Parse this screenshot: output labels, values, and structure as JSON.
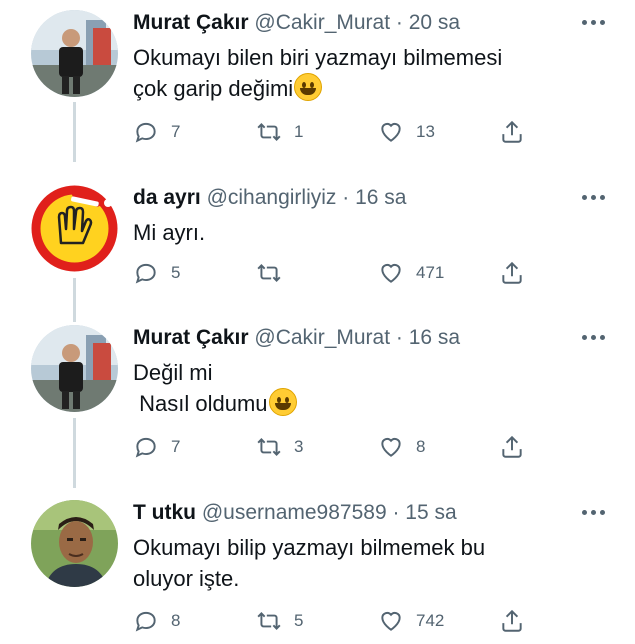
{
  "tweets": [
    {
      "name": "Murat Çakır",
      "handle": "@Cakir_Murat",
      "time": "20 sa",
      "lines": [
        "Okumayı bilen biri yazmayı bilmemesi",
        "çok garip değimi"
      ],
      "emoji_on_line": 1,
      "avatar_icon": "man-photo-avatar",
      "replies": "7",
      "retweets": "1",
      "likes": "13"
    },
    {
      "name": "da ayrı",
      "handle": "@cihangirliyiz",
      "time": "16 sa",
      "lines": [
        "Mi ayrı."
      ],
      "emoji_on_line": -1,
      "avatar_icon": "hand-logo-avatar",
      "replies": "5",
      "retweets": "",
      "likes": "471"
    },
    {
      "name": "Murat Çakır",
      "handle": "@Cakir_Murat",
      "time": "16 sa",
      "lines": [
        "Değil mi",
        " Nasıl oldumu"
      ],
      "emoji_on_line": 1,
      "avatar_icon": "man-photo-avatar",
      "replies": "7",
      "retweets": "3",
      "likes": "8"
    },
    {
      "name": "T utku",
      "handle": "@username987589",
      "time": "15 sa",
      "lines": [
        "Okumayı bilip yazmayı bilmemek bu",
        "oluyor işte."
      ],
      "emoji_on_line": -1,
      "avatar_icon": "selfie-photo-avatar",
      "replies": "8",
      "retweets": "5",
      "likes": "742"
    }
  ],
  "colors": {
    "text": "#0f1419",
    "secondary": "#536471",
    "thread_line": "#cfd9de"
  }
}
